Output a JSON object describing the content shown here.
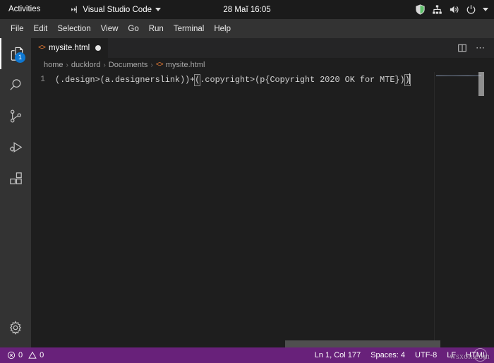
{
  "desktop": {
    "activities_label": "Activities",
    "app_menu_label": "Visual Studio Code",
    "clock": "28 Маĭ  16:05",
    "tray": {
      "shield_icon": "shield-icon",
      "network_icon": "network-icon",
      "volume_icon": "volume-icon",
      "power_icon": "power-icon",
      "caret_icon": "chevron-down-icon"
    },
    "topbar_bg": "#1b1b1b"
  },
  "menubar": {
    "items": [
      {
        "label": "File"
      },
      {
        "label": "Edit"
      },
      {
        "label": "Selection"
      },
      {
        "label": "View"
      },
      {
        "label": "Go"
      },
      {
        "label": "Run"
      },
      {
        "label": "Terminal"
      },
      {
        "label": "Help"
      }
    ]
  },
  "activitybar": {
    "items": [
      {
        "name": "explorer",
        "icon": "files-icon",
        "badge": "1",
        "active": true
      },
      {
        "name": "search",
        "icon": "search-icon",
        "badge": "",
        "active": false
      },
      {
        "name": "source-control",
        "icon": "source-control-icon",
        "badge": "",
        "active": false
      },
      {
        "name": "run-debug",
        "icon": "run-and-debug-icon",
        "badge": "",
        "active": false
      },
      {
        "name": "extensions",
        "icon": "extensions-icon",
        "badge": "",
        "active": false
      }
    ],
    "manage": {
      "name": "manage",
      "icon": "gear-icon"
    },
    "bg": "#333333"
  },
  "editor": {
    "tab": {
      "file_icon": "<>",
      "label": "mysite.html",
      "dirty": true,
      "dirty_indicator": "unsaved-dot"
    },
    "tab_actions": {
      "split_icon": "split-editor-icon",
      "more_icon": "⋯"
    },
    "breadcrumbs": [
      {
        "label": "home"
      },
      {
        "label": "ducklord"
      },
      {
        "label": "Documents"
      },
      {
        "label": "mysite.html",
        "icon": "<>"
      }
    ],
    "breadcrumb_separator": "›",
    "line_number": "1",
    "code": {
      "prefix": "(.design>(a.designerslink))+",
      "open_bracket": "(",
      "middle": ".copyright>(p{Copyright 2020 OK for MTE})",
      "close_bracket": ")"
    },
    "accent_html_icon_color": "#e37933"
  },
  "statusbar": {
    "bg": "#68217a",
    "errors": {
      "icon": "error-icon",
      "count": "0"
    },
    "warnings": {
      "icon": "warning-icon",
      "count": "0"
    },
    "position": "Ln 1, Col 177",
    "indentation": "Spaces: 4",
    "encoding": "UTF-8",
    "eol": "LF",
    "language": "HTML"
  },
  "watermark": {
    "text": "wsxon.com"
  }
}
